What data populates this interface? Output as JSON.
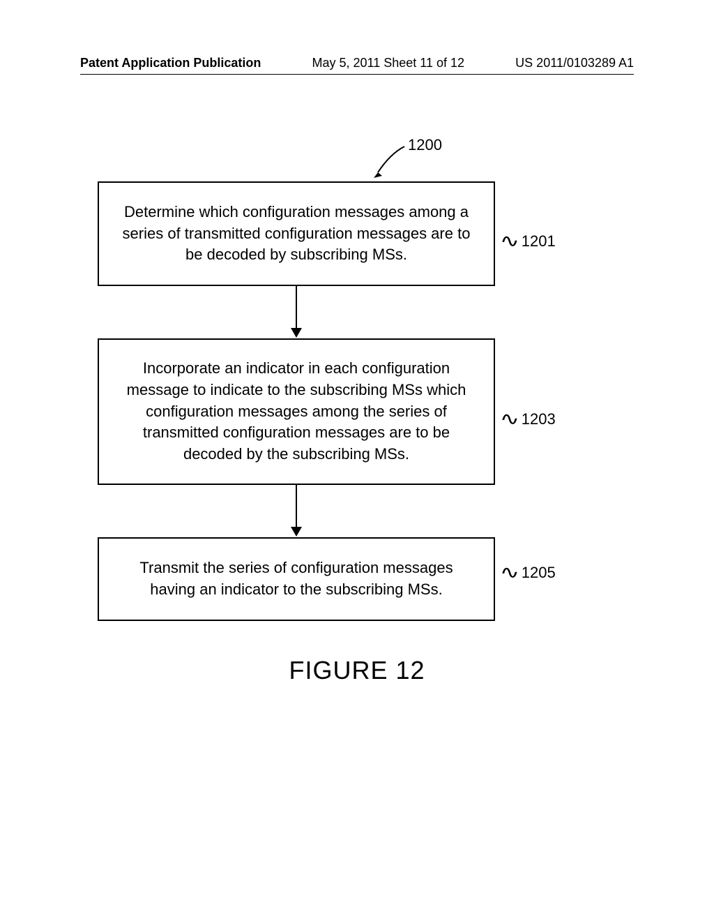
{
  "header": {
    "left": "Patent Application Publication",
    "center": "May 5, 2011  Sheet 11 of 12",
    "right": "US 2011/0103289 A1"
  },
  "diagram": {
    "ref_main": "1200",
    "boxes": [
      {
        "text": "Determine which configuration messages among a series of transmitted configuration messages are to be decoded by subscribing MSs.",
        "ref": "1201"
      },
      {
        "text": "Incorporate an indicator in each configuration message to indicate to the subscribing MSs which configuration messages among the series of transmitted configuration messages are to be decoded by the subscribing MSs.",
        "ref": "1203"
      },
      {
        "text": "Transmit the series of configuration messages having an indicator to the subscribing MSs.",
        "ref": "1205"
      }
    ]
  },
  "caption": "FIGURE 12"
}
